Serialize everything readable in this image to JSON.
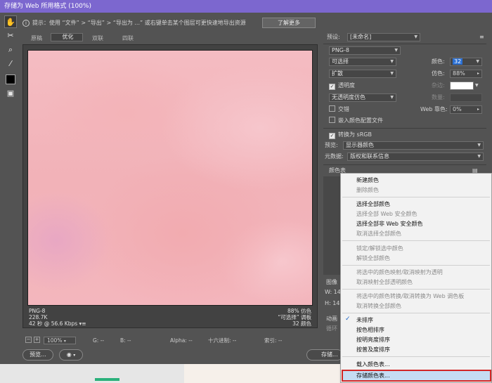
{
  "window": {
    "title": "存储为 Web 所用格式 (100%)"
  },
  "hint": {
    "text": "提示：使用 “文件” > “导出” > “导出为 ...” 或右键单击某个图层可更快速地导出资源",
    "learn_more": "了解更多"
  },
  "tabs": [
    {
      "label": "原稿"
    },
    {
      "label": "优化"
    },
    {
      "label": "双联"
    },
    {
      "label": "四联"
    }
  ],
  "preview_info": {
    "format": "PNG-8",
    "size": "228.7K",
    "time": "42 秒 @ 56.6 Kbps",
    "dither": "88% 仿色",
    "palette": "“可选择” 调板",
    "colors": "32 颜色"
  },
  "zoom": {
    "value": "100%",
    "g": "G: --",
    "b": "B: --",
    "alpha": "Alpha: --",
    "hex": "十六进制: --",
    "index": "索引: --"
  },
  "buttons": {
    "preview": "预览...",
    "save": "存储..."
  },
  "settings": {
    "preset_label": "预设:",
    "preset_value": "[未命名]",
    "format": "PNG-8",
    "reduction": "可选择",
    "colors_label": "颜色:",
    "colors_value": "32",
    "dither_algo": "扩散",
    "dither_label": "仿色:",
    "dither_value": "88%",
    "transparency": "透明度",
    "matte_label": "杂边:",
    "transp_dither": "无透明度仿色",
    "amount_label": "数量:",
    "interlaced": "交错",
    "web_snap_label": "Web 靠色:",
    "web_snap_value": "0%",
    "embed_profile": "嵌入颜色配置文件",
    "convert_srgb": "转换为 sRGB",
    "preview_label": "预览:",
    "preview_value": "显示器颜色",
    "metadata_label": "元数据:",
    "metadata_value": "版权和联系信息",
    "color_table": "颜色表",
    "image_size": "图像",
    "animation": "动画",
    "loop": "循环"
  },
  "menu": {
    "items": [
      {
        "label": "新建颜色",
        "enabled": true
      },
      {
        "label": "删除颜色",
        "enabled": false
      },
      {
        "label": "选择全部颜色",
        "enabled": true
      },
      {
        "label": "选择全部 Web 安全颜色",
        "enabled": false
      },
      {
        "label": "选择全部非 Web 安全颜色",
        "enabled": true
      },
      {
        "label": "取消选择全部颜色",
        "enabled": false
      },
      {
        "label": "锁定/解锁选中颜色",
        "enabled": false
      },
      {
        "label": "解锁全部颜色",
        "enabled": false
      },
      {
        "label": "将选中的颜色映射/取消映射为透明",
        "enabled": false
      },
      {
        "label": "取消映射全部透明颜色",
        "enabled": false
      },
      {
        "label": "将选中的颜色转换/取消转换为 Web 调色板",
        "enabled": false
      },
      {
        "label": "取消转换全部颜色",
        "enabled": false
      },
      {
        "label": "未排序",
        "enabled": true,
        "checked": true
      },
      {
        "label": "按色相排序",
        "enabled": true
      },
      {
        "label": "按明亮度排序",
        "enabled": true
      },
      {
        "label": "按普及度排序",
        "enabled": true
      },
      {
        "label": "载入颜色表...",
        "enabled": true
      },
      {
        "label": "存储颜色表...",
        "enabled": true,
        "highlighted": true
      }
    ]
  },
  "colors": {
    "accent": "#7c67cf",
    "highlight_border": "#d32727"
  }
}
